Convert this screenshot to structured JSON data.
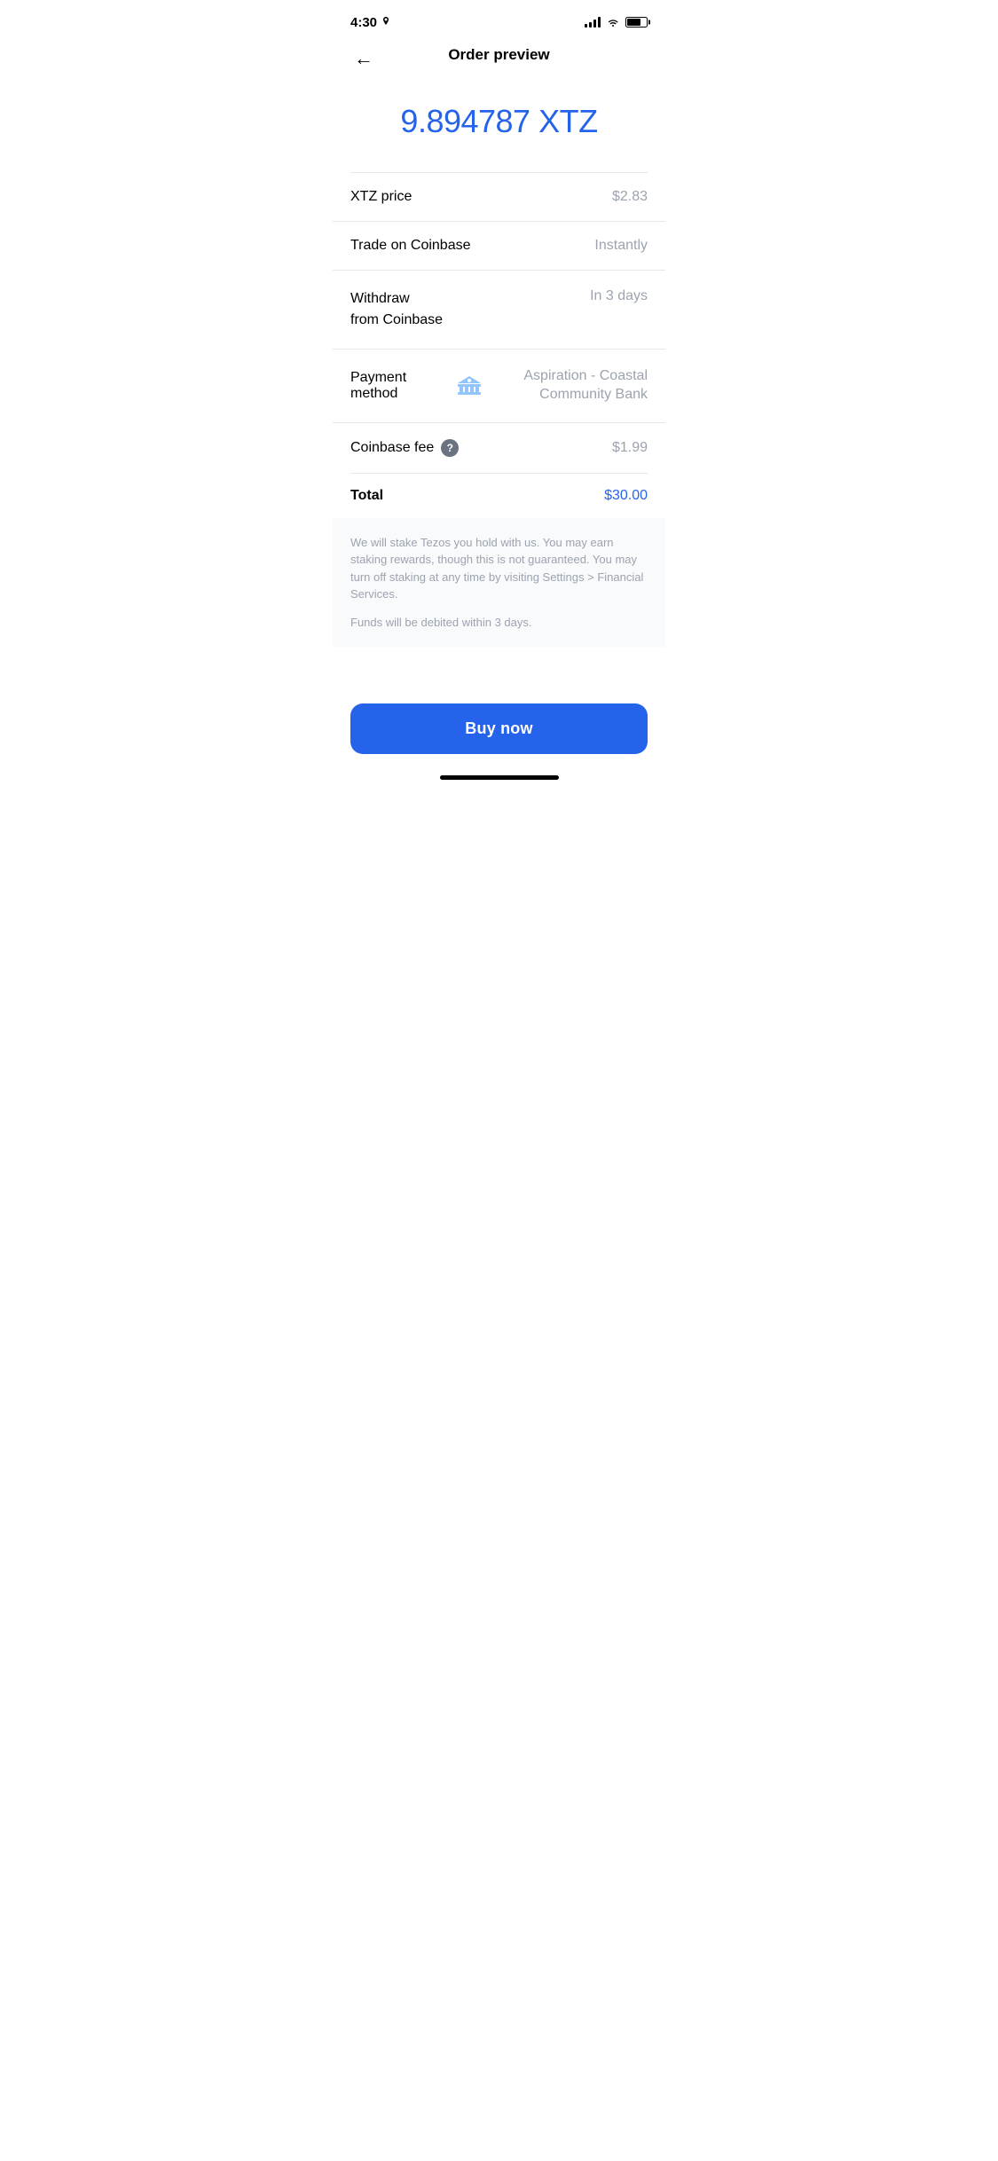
{
  "statusBar": {
    "time": "4:30",
    "locationIcon": "location-icon"
  },
  "header": {
    "backLabel": "←",
    "title": "Order preview"
  },
  "amount": {
    "value": "9.894787 XTZ"
  },
  "details": [
    {
      "label": "XTZ price",
      "value": "$2.83"
    },
    {
      "label": "Trade on Coinbase",
      "value": "Instantly"
    },
    {
      "labelLine1": "Withdraw",
      "labelLine2": "from Coinbase",
      "value": "In 3 days"
    }
  ],
  "payment": {
    "label": "Payment method",
    "bankName": "Aspiration - Coastal Community Bank"
  },
  "fee": {
    "label": "Coinbase fee",
    "helpIcon": "?",
    "value": "$1.99"
  },
  "total": {
    "label": "Total",
    "value": "$30.00"
  },
  "disclaimer": {
    "staking": "We will stake Tezos you hold with us. You may earn staking rewards, though this is not guaranteed. You may turn off staking at any time by visiting Settings > Financial Services.",
    "funds": "Funds will be debited within 3 days."
  },
  "buyButton": {
    "label": "Buy now"
  }
}
